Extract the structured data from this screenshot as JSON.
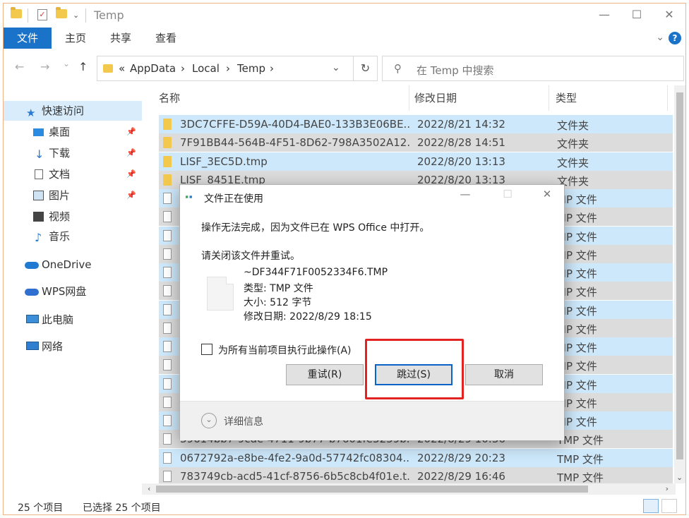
{
  "window": {
    "title": "Temp",
    "controls": {
      "minimize": "—",
      "maximize": "☐",
      "close": "✕"
    }
  },
  "ribbon": {
    "tabs": [
      {
        "label": "文件"
      },
      {
        "label": "主页"
      },
      {
        "label": "共享"
      },
      {
        "label": "查看"
      }
    ],
    "help": "?"
  },
  "nav": {
    "back": "←",
    "forward": "→",
    "recent": "⌄",
    "up": "↑",
    "breadcrumb": [
      "«",
      "AppData",
      "›",
      "Local",
      "›",
      "Temp",
      "›"
    ],
    "refresh": "↻",
    "search_placeholder": "在 Temp 中搜索"
  },
  "sidebar": {
    "items": [
      {
        "label": "快速访问",
        "icon": "star-icon",
        "selected": true
      },
      {
        "label": "桌面",
        "icon": "desktop-icon",
        "pinned": true
      },
      {
        "label": "下载",
        "icon": "download-icon",
        "pinned": true
      },
      {
        "label": "文档",
        "icon": "document-icon",
        "pinned": true
      },
      {
        "label": "图片",
        "icon": "picture-icon",
        "pinned": true
      },
      {
        "label": "视频",
        "icon": "video-icon"
      },
      {
        "label": "音乐",
        "icon": "music-icon"
      },
      {
        "label": "OneDrive",
        "icon": "cloud-icon"
      },
      {
        "label": "WPS网盘",
        "icon": "wps-cloud-icon"
      },
      {
        "label": "此电脑",
        "icon": "computer-icon"
      },
      {
        "label": "网络",
        "icon": "network-icon"
      }
    ]
  },
  "filelist": {
    "columns": {
      "name": "名称",
      "date": "修改日期",
      "type": "类型"
    },
    "rows": [
      {
        "name": "3DC7CFFE-D59A-40D4-BAE0-133B3E06BE...",
        "date": "2022/8/21 14:32",
        "type": "文件夹",
        "kind": "folder"
      },
      {
        "name": "7F91BB44-564B-4F51-8D62-798A3502A12...",
        "date": "2022/8/28 14:51",
        "type": "文件夹",
        "kind": "folder"
      },
      {
        "name": "LISF_3EC5D.tmp",
        "date": "2022/8/20 13:13",
        "type": "文件夹",
        "kind": "folder"
      },
      {
        "name": "LISF_8451E.tmp",
        "date": "2022/8/20 13:13",
        "type": "文件夹",
        "kind": "folder"
      },
      {
        "name": "",
        "date": "",
        "type": "MP 文件",
        "kind": "file"
      },
      {
        "name": "",
        "date": "",
        "type": "MP 文件",
        "kind": "file"
      },
      {
        "name": "",
        "date": "",
        "type": "MP 文件",
        "kind": "file"
      },
      {
        "name": "",
        "date": "",
        "type": "MP 文件",
        "kind": "file"
      },
      {
        "name": "",
        "date": "",
        "type": "MP 文件",
        "kind": "file"
      },
      {
        "name": "",
        "date": "",
        "type": "MP 文件",
        "kind": "file"
      },
      {
        "name": "",
        "date": "",
        "type": "MP 文件",
        "kind": "file"
      },
      {
        "name": "",
        "date": "",
        "type": "MP 文件",
        "kind": "file"
      },
      {
        "name": "",
        "date": "",
        "type": "MP 文件",
        "kind": "file"
      },
      {
        "name": "",
        "date": "",
        "type": "MP 文件",
        "kind": "file"
      },
      {
        "name": "",
        "date": "",
        "type": "MP 文件",
        "kind": "file"
      },
      {
        "name": "",
        "date": "",
        "type": "MP 文件",
        "kind": "file"
      },
      {
        "name": "",
        "date": "",
        "type": "MP 文件",
        "kind": "file"
      },
      {
        "name": "39614bb7-9cde-4711-9b77-b7601fe3259b...",
        "date": "2022/8/29 10:36",
        "type": "TMP 文件",
        "kind": "file"
      },
      {
        "name": "0672792a-e8be-4fe2-9a0d-57742fc08304...",
        "date": "2022/8/29 20:23",
        "type": "TMP 文件",
        "kind": "file"
      },
      {
        "name": "783749cb-acd5-41cf-8756-6b5c8cb4f01e.t...",
        "date": "2022/8/29 16:46",
        "type": "TMP 文件",
        "kind": "file"
      }
    ]
  },
  "status": {
    "count": "25 个项目",
    "selected": "已选择 25 个项目"
  },
  "dialog": {
    "title": "文件正在使用",
    "controls": {
      "minimize": "—",
      "maximize": "☐",
      "close": "✕"
    },
    "message": "操作无法完成，因为文件已在 WPS Office 中打开。",
    "instruction": "请关闭该文件并重试。",
    "file": {
      "name": "~DF344F71F0052334F6.TMP",
      "type": "类型: TMP 文件",
      "size": "大小: 512 字节",
      "modified": "修改日期: 2022/8/29 18:15"
    },
    "apply_all": "为所有当前项目执行此操作(A)",
    "apply_all_checked": false,
    "buttons": {
      "retry": "重试(R)",
      "skip": "跳过(S)",
      "cancel": "取消"
    },
    "details": "详细信息"
  },
  "colors": {
    "accent": "#1a73c9",
    "selection": "#cde8fb",
    "highlight_box": "#e32222"
  }
}
